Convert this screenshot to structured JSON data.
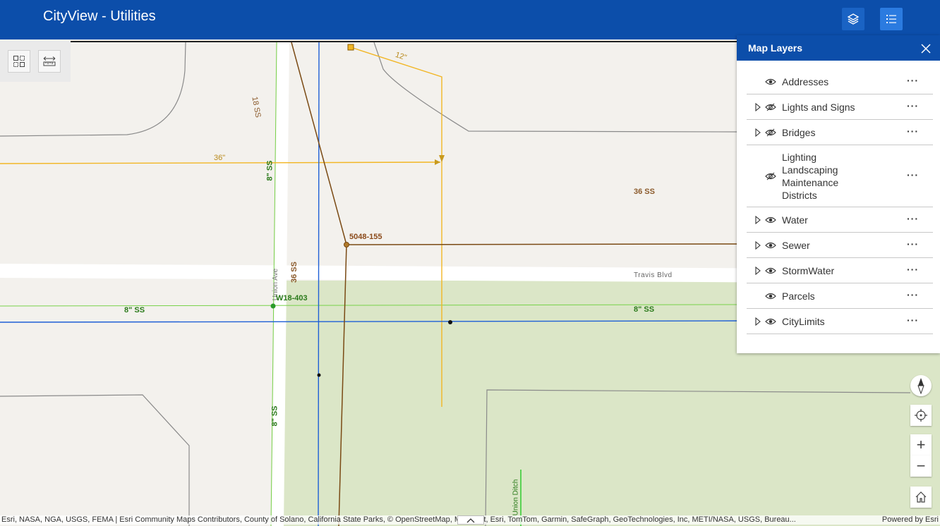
{
  "app": {
    "title": "CityView - Utilities"
  },
  "toolbar": {
    "layers_icon": "layers-icon",
    "legend_icon": "list-icon"
  },
  "map_tools": {
    "select_icon": "select-icon",
    "measure_icon": "ruler-icon"
  },
  "layer_panel": {
    "title": "Map Layers",
    "close_icon": "close-icon",
    "layers": [
      {
        "label": "Addresses",
        "expandable": false,
        "visible": true
      },
      {
        "label": "Lights and Signs",
        "expandable": true,
        "visible": false
      },
      {
        "label": "Bridges",
        "expandable": true,
        "visible": false
      },
      {
        "label": "Lighting Landscaping Maintenance Districts",
        "expandable": false,
        "visible": false
      },
      {
        "label": "Water",
        "expandable": true,
        "visible": true
      },
      {
        "label": "Sewer",
        "expandable": true,
        "visible": true
      },
      {
        "label": "StormWater",
        "expandable": true,
        "visible": true
      },
      {
        "label": "Parcels",
        "expandable": false,
        "visible": true
      },
      {
        "label": "CityLimits",
        "expandable": true,
        "visible": true
      }
    ],
    "more_label": "···"
  },
  "map_labels": {
    "pipe_36": "36\"",
    "pipe_12": "12\"",
    "ss_18": "18 SS",
    "ss_8_vertical_top": "8\" SS",
    "ss_36_right": "36 SS",
    "node_5048": "5048-155",
    "ss_36_vertical": "36 SS",
    "union_ave": "Union Ave",
    "travis_blvd": "Travis Blvd",
    "node_w18": "W18-403",
    "ss_8_left": "8\" SS",
    "ss_8_right": "8\" SS",
    "ss_8_vertical_bottom": "8\" SS",
    "union_ditch": "Union Ditch"
  },
  "map_controls": {
    "compass_icon": "compass-icon",
    "locate_icon": "locate-icon",
    "zoom_in": "+",
    "zoom_out": "−",
    "home_icon": "home-icon"
  },
  "attribution": {
    "text": "Esri, NASA, NGA, USGS, FEMA | Esri Community Maps Contributors, County of Solano, California State Parks, © OpenStreetMap, Microsoft, Esri, TomTom, Garmin, SafeGraph, GeoTechnologies, Inc, METI/NASA, USGS, Bureau...",
    "powered": "Powered by Esri"
  },
  "colors": {
    "header": "#0c4eaa",
    "water_main": "#1e5fd6",
    "storm": "#7a4a14",
    "sewer": "#f2b624",
    "sewer_green": "#78d24a",
    "park": "#dbe6c7"
  }
}
